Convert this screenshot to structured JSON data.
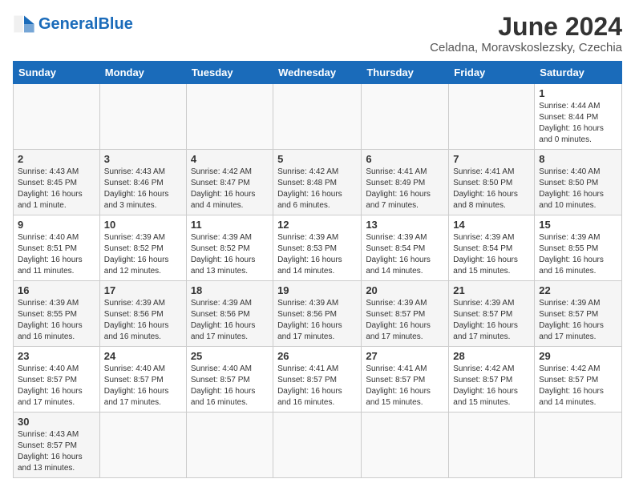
{
  "header": {
    "logo_general": "General",
    "logo_blue": "Blue",
    "title": "June 2024",
    "subtitle": "Celadna, Moravskoslezsky, Czechia"
  },
  "weekdays": [
    "Sunday",
    "Monday",
    "Tuesday",
    "Wednesday",
    "Thursday",
    "Friday",
    "Saturday"
  ],
  "weeks": [
    [
      {
        "day": "",
        "info": ""
      },
      {
        "day": "",
        "info": ""
      },
      {
        "day": "",
        "info": ""
      },
      {
        "day": "",
        "info": ""
      },
      {
        "day": "",
        "info": ""
      },
      {
        "day": "",
        "info": ""
      },
      {
        "day": "1",
        "info": "Sunrise: 4:44 AM\nSunset: 8:44 PM\nDaylight: 16 hours\nand 0 minutes."
      }
    ],
    [
      {
        "day": "2",
        "info": "Sunrise: 4:43 AM\nSunset: 8:45 PM\nDaylight: 16 hours\nand 1 minute."
      },
      {
        "day": "3",
        "info": "Sunrise: 4:43 AM\nSunset: 8:46 PM\nDaylight: 16 hours\nand 3 minutes."
      },
      {
        "day": "4",
        "info": "Sunrise: 4:42 AM\nSunset: 8:47 PM\nDaylight: 16 hours\nand 4 minutes."
      },
      {
        "day": "5",
        "info": "Sunrise: 4:42 AM\nSunset: 8:48 PM\nDaylight: 16 hours\nand 6 minutes."
      },
      {
        "day": "6",
        "info": "Sunrise: 4:41 AM\nSunset: 8:49 PM\nDaylight: 16 hours\nand 7 minutes."
      },
      {
        "day": "7",
        "info": "Sunrise: 4:41 AM\nSunset: 8:50 PM\nDaylight: 16 hours\nand 8 minutes."
      },
      {
        "day": "8",
        "info": "Sunrise: 4:40 AM\nSunset: 8:50 PM\nDaylight: 16 hours\nand 10 minutes."
      }
    ],
    [
      {
        "day": "9",
        "info": "Sunrise: 4:40 AM\nSunset: 8:51 PM\nDaylight: 16 hours\nand 11 minutes."
      },
      {
        "day": "10",
        "info": "Sunrise: 4:39 AM\nSunset: 8:52 PM\nDaylight: 16 hours\nand 12 minutes."
      },
      {
        "day": "11",
        "info": "Sunrise: 4:39 AM\nSunset: 8:52 PM\nDaylight: 16 hours\nand 13 minutes."
      },
      {
        "day": "12",
        "info": "Sunrise: 4:39 AM\nSunset: 8:53 PM\nDaylight: 16 hours\nand 14 minutes."
      },
      {
        "day": "13",
        "info": "Sunrise: 4:39 AM\nSunset: 8:54 PM\nDaylight: 16 hours\nand 14 minutes."
      },
      {
        "day": "14",
        "info": "Sunrise: 4:39 AM\nSunset: 8:54 PM\nDaylight: 16 hours\nand 15 minutes."
      },
      {
        "day": "15",
        "info": "Sunrise: 4:39 AM\nSunset: 8:55 PM\nDaylight: 16 hours\nand 16 minutes."
      }
    ],
    [
      {
        "day": "16",
        "info": "Sunrise: 4:39 AM\nSunset: 8:55 PM\nDaylight: 16 hours\nand 16 minutes."
      },
      {
        "day": "17",
        "info": "Sunrise: 4:39 AM\nSunset: 8:56 PM\nDaylight: 16 hours\nand 16 minutes."
      },
      {
        "day": "18",
        "info": "Sunrise: 4:39 AM\nSunset: 8:56 PM\nDaylight: 16 hours\nand 17 minutes."
      },
      {
        "day": "19",
        "info": "Sunrise: 4:39 AM\nSunset: 8:56 PM\nDaylight: 16 hours\nand 17 minutes."
      },
      {
        "day": "20",
        "info": "Sunrise: 4:39 AM\nSunset: 8:57 PM\nDaylight: 16 hours\nand 17 minutes."
      },
      {
        "day": "21",
        "info": "Sunrise: 4:39 AM\nSunset: 8:57 PM\nDaylight: 16 hours\nand 17 minutes."
      },
      {
        "day": "22",
        "info": "Sunrise: 4:39 AM\nSunset: 8:57 PM\nDaylight: 16 hours\nand 17 minutes."
      }
    ],
    [
      {
        "day": "23",
        "info": "Sunrise: 4:40 AM\nSunset: 8:57 PM\nDaylight: 16 hours\nand 17 minutes."
      },
      {
        "day": "24",
        "info": "Sunrise: 4:40 AM\nSunset: 8:57 PM\nDaylight: 16 hours\nand 17 minutes."
      },
      {
        "day": "25",
        "info": "Sunrise: 4:40 AM\nSunset: 8:57 PM\nDaylight: 16 hours\nand 16 minutes."
      },
      {
        "day": "26",
        "info": "Sunrise: 4:41 AM\nSunset: 8:57 PM\nDaylight: 16 hours\nand 16 minutes."
      },
      {
        "day": "27",
        "info": "Sunrise: 4:41 AM\nSunset: 8:57 PM\nDaylight: 16 hours\nand 15 minutes."
      },
      {
        "day": "28",
        "info": "Sunrise: 4:42 AM\nSunset: 8:57 PM\nDaylight: 16 hours\nand 15 minutes."
      },
      {
        "day": "29",
        "info": "Sunrise: 4:42 AM\nSunset: 8:57 PM\nDaylight: 16 hours\nand 14 minutes."
      }
    ],
    [
      {
        "day": "30",
        "info": "Sunrise: 4:43 AM\nSunset: 8:57 PM\nDaylight: 16 hours\nand 13 minutes."
      },
      {
        "day": "",
        "info": ""
      },
      {
        "day": "",
        "info": ""
      },
      {
        "day": "",
        "info": ""
      },
      {
        "day": "",
        "info": ""
      },
      {
        "day": "",
        "info": ""
      },
      {
        "day": "",
        "info": ""
      }
    ]
  ]
}
